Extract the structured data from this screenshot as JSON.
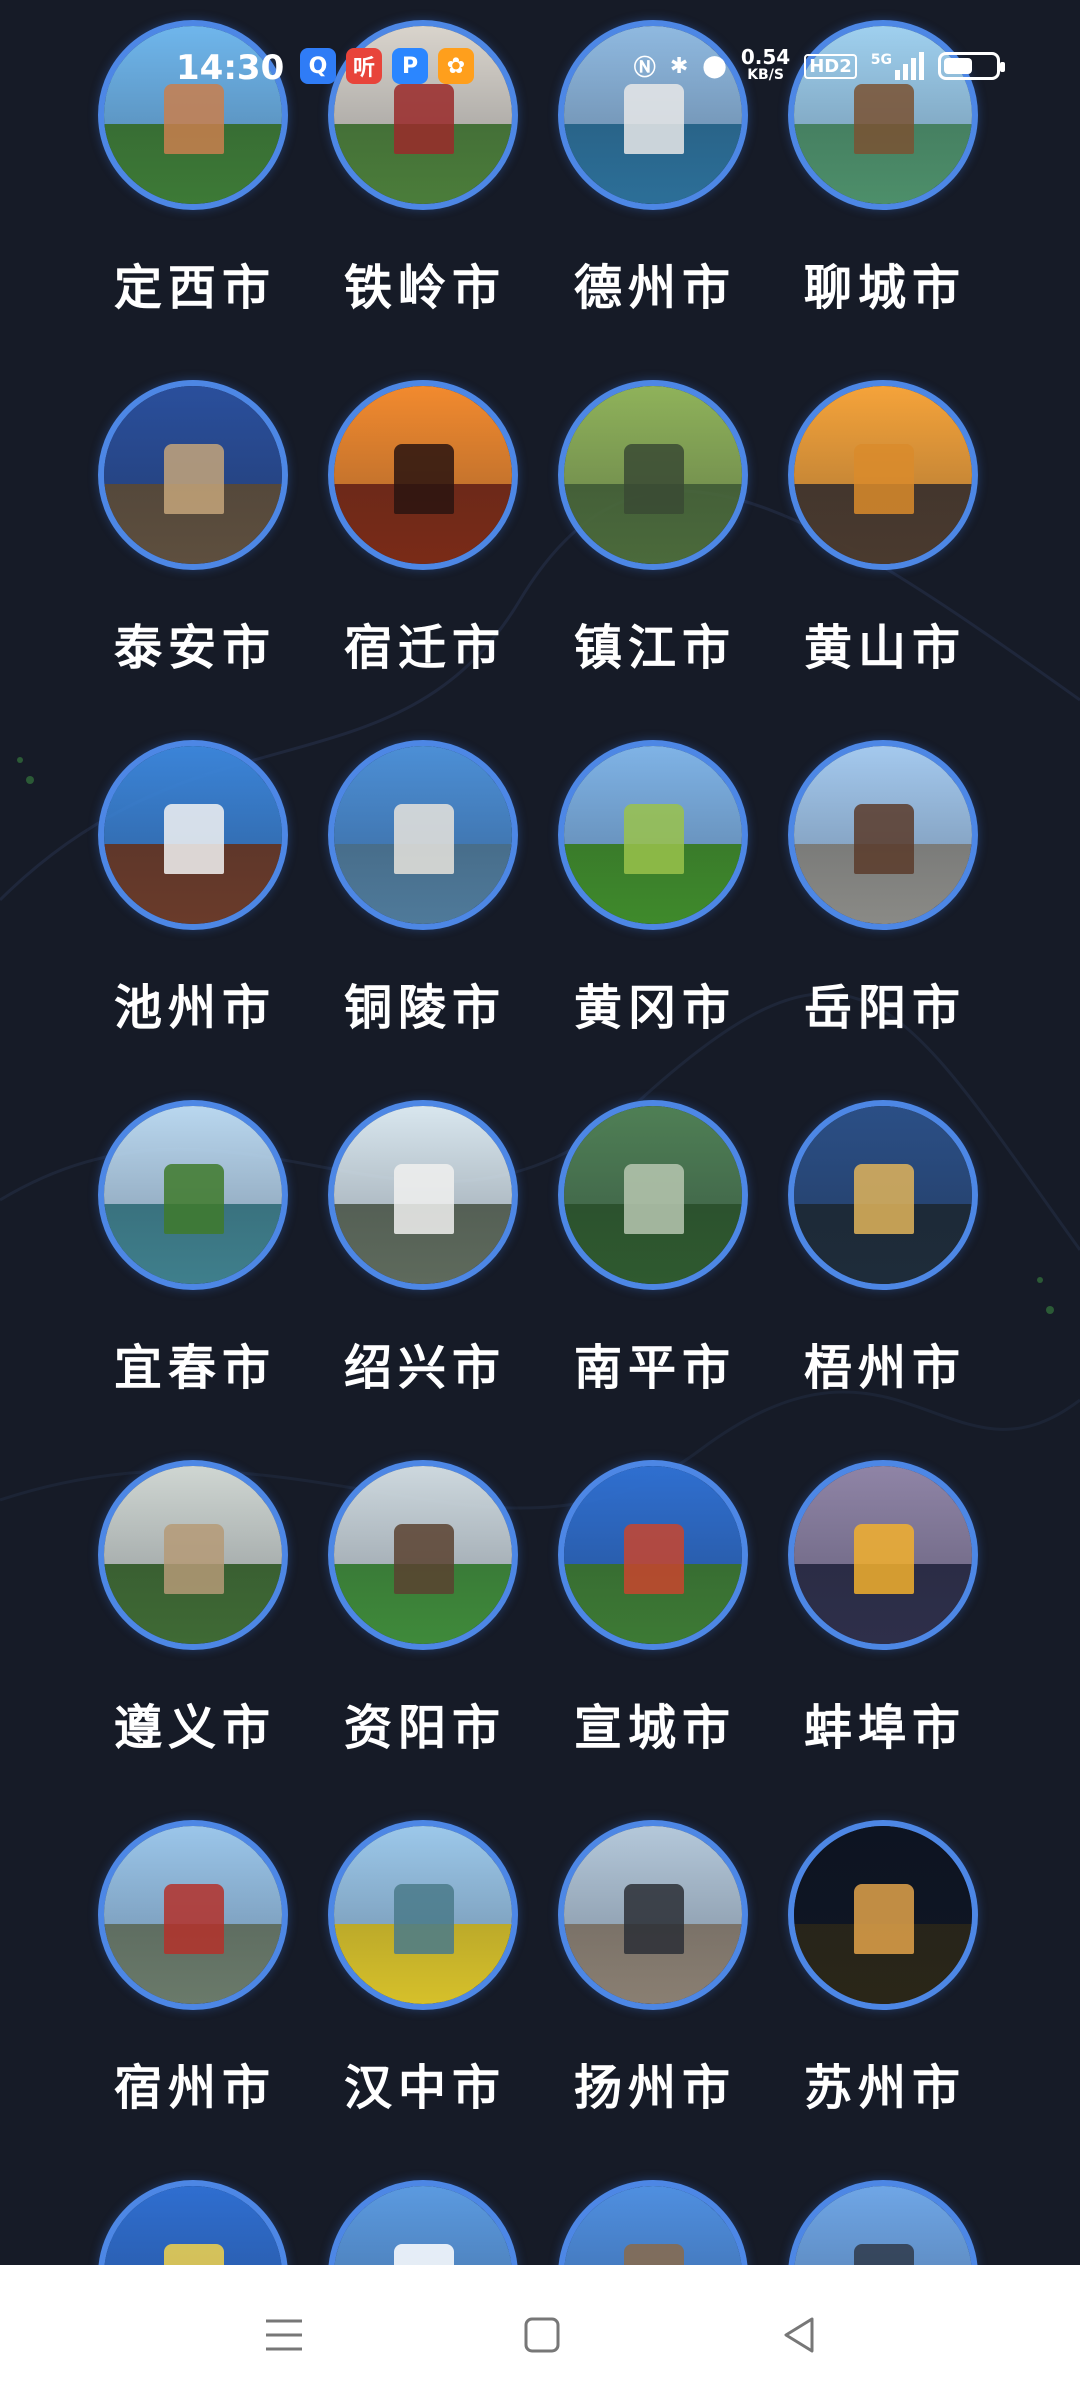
{
  "status_bar": {
    "time": "14:30",
    "network_speed_value": "0.54",
    "network_speed_unit": "KB/S",
    "hd_label": "HD2",
    "signal_label": "5G",
    "battery_level": 0.55,
    "app_icons": [
      {
        "name": "qq-browser-icon",
        "color": "#2f7cf6",
        "glyph": "Q"
      },
      {
        "name": "ting-app-icon",
        "color": "#e8443a",
        "glyph": "听"
      },
      {
        "name": "p-app-icon",
        "color": "#2b86ff",
        "glyph": "P"
      },
      {
        "name": "pinwheel-app-icon",
        "color": "#ff9f1c",
        "glyph": "✿"
      }
    ],
    "system_icons": [
      "nfc-icon",
      "bluetooth-icon",
      "location-icon",
      "signal-icon",
      "battery-icon"
    ]
  },
  "cities": [
    {
      "label": "定西市",
      "sky": "#6fb6ec",
      "land": "#3d7a36",
      "feature": "#c97f4d"
    },
    {
      "label": "铁岭市",
      "sky": "#d9d4cc",
      "land": "#4b7d3a",
      "feature": "#9a2a2a"
    },
    {
      "label": "德州市",
      "sky": "#8fb9e0",
      "land": "#2c6f98",
      "feature": "#e8e8e8"
    },
    {
      "label": "聊城市",
      "sky": "#9fd0ef",
      "land": "#4d8f6a",
      "feature": "#7a5232"
    },
    {
      "label": "泰安市",
      "sky": "#2a4f9c",
      "land": "#5e4f3e",
      "feature": "#c4a47a"
    },
    {
      "label": "宿迁市",
      "sky": "#f28a2e",
      "land": "#7a2b17",
      "feature": "#2a1410"
    },
    {
      "label": "镇江市",
      "sky": "#8fb25a",
      "land": "#4b6a3b",
      "feature": "#3a4a34"
    },
    {
      "label": "黄山市",
      "sky": "#f5a33a",
      "land": "#4a3a2e",
      "feature": "#d98b2b"
    },
    {
      "label": "池州市",
      "sky": "#3b84d8",
      "land": "#6a3b2a",
      "feature": "#f2f2f2"
    },
    {
      "label": "铜陵市",
      "sky": "#4c8fd6",
      "land": "#4f7a9a",
      "feature": "#e6e3dc"
    },
    {
      "label": "黄冈市",
      "sky": "#7fb3e6",
      "land": "#3f8a2b",
      "feature": "#9ac24b"
    },
    {
      "label": "岳阳市",
      "sky": "#a4c9ee",
      "land": "#8a8a86",
      "feature": "#5b3b2a"
    },
    {
      "label": "宜春市",
      "sky": "#b9d7ef",
      "land": "#3f7f8c",
      "feature": "#3f7a2b"
    },
    {
      "label": "绍兴市",
      "sky": "#d8e6ee",
      "land": "#5e6a5c",
      "feature": "#f0f0ee"
    },
    {
      "label": "南平市",
      "sky": "#4f7f55",
      "land": "#2f5a2f",
      "feature": "#b7c7b0"
    },
    {
      "label": "梧州市",
      "sky": "#2b4f86",
      "land": "#1e2c3a",
      "feature": "#e0b45a"
    },
    {
      "label": "遵义市",
      "sky": "#cfd6d2",
      "land": "#3f6a34",
      "feature": "#b59a77"
    },
    {
      "label": "资阳市",
      "sky": "#cdd8de",
      "land": "#3f8a3a",
      "feature": "#5a4230"
    },
    {
      "label": "宣城市",
      "sky": "#2f6fd0",
      "land": "#3d7a34",
      "feature": "#c8452e"
    },
    {
      "label": "蚌埠市",
      "sky": "#8f84a6",
      "land": "#2e2f4a",
      "feature": "#f2b02e"
    },
    {
      "label": "宿州市",
      "sky": "#9bc6ea",
      "land": "#6a7a6a",
      "feature": "#b4312a"
    },
    {
      "label": "汉中市",
      "sky": "#9cc8ea",
      "land": "#d6c02a",
      "feature": "#4a7a8a"
    },
    {
      "label": "扬州市",
      "sky": "#b4c8da",
      "land": "#8a7f72",
      "feature": "#2b2f36"
    },
    {
      "label": "苏州市",
      "sky": "#0d1422",
      "land": "#2a2618",
      "feature": "#e0a24a"
    },
    {
      "label": "",
      "sky": "#2f6ed0",
      "land": "#5c87c0",
      "feature": "#f2d24a"
    },
    {
      "label": "",
      "sky": "#5b9ae0",
      "land": "#c8d2da",
      "feature": "#ffffff"
    },
    {
      "label": "",
      "sky": "#4f8fe0",
      "land": "#c2b8a6",
      "feature": "#8a6a4a"
    },
    {
      "label": "",
      "sky": "#6fa6e6",
      "land": "#dfe6ee",
      "feature": "#2f3a4a"
    }
  ],
  "nav_bar": {
    "buttons": [
      "menu-icon",
      "home-icon",
      "back-icon"
    ]
  }
}
